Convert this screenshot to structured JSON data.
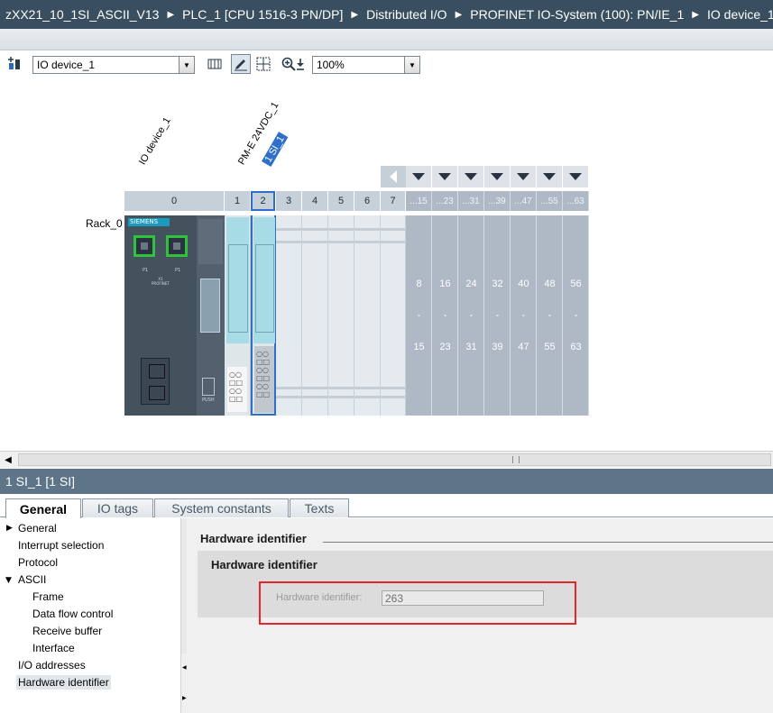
{
  "breadcrumb": [
    "zXX21_10_1SI_ASCII_V13",
    "PLC_1 [CPU 1516-3 PN/DP]",
    "Distributed I/O",
    "PROFINET IO-System (100): PN/IE_1",
    "IO device_1"
  ],
  "breadcrumb_separator": "▶",
  "toolbar": {
    "device_select": "IO device_1",
    "zoom_select": "100%"
  },
  "device_view": {
    "device_label": "IO device_1",
    "module_label": "PM-E 24VDC_1",
    "selected_module_label": "1 SI_1",
    "rack_label": "Rack_0",
    "slots": [
      "0",
      "1",
      "2",
      "3",
      "4",
      "5",
      "6",
      "7"
    ],
    "ext_headers": [
      "...15",
      "...23",
      "...31",
      "...39",
      "...47",
      "...55",
      "...63"
    ],
    "ext_top": [
      "8",
      "16",
      "24",
      "32",
      "40",
      "48",
      "56"
    ],
    "ext_dash": "-",
    "ext_bottom": [
      "15",
      "23",
      "31",
      "39",
      "47",
      "55",
      "63"
    ],
    "cpu_brand": "SIEMENS",
    "port_labels": [
      "P1",
      "P1"
    ],
    "cpu_text": "X1\nPROFINET",
    "push_label": "PUSH"
  },
  "properties": {
    "title": "1 SI_1 [1 SI]",
    "tabs": [
      "General",
      "IO tags",
      "System constants",
      "Texts"
    ],
    "nav": [
      {
        "label": "General",
        "level": 0,
        "caret": "▶"
      },
      {
        "label": "Interrupt selection",
        "level": 0
      },
      {
        "label": "Protocol",
        "level": 0
      },
      {
        "label": "ASCII",
        "level": 0,
        "caret": "▼"
      },
      {
        "label": "Frame",
        "level": 1
      },
      {
        "label": "Data flow control",
        "level": 1
      },
      {
        "label": "Receive buffer",
        "level": 1
      },
      {
        "label": "Interface",
        "level": 1
      },
      {
        "label": "I/O addresses",
        "level": 0
      },
      {
        "label": "Hardware identifier",
        "level": 0,
        "selected": true
      }
    ],
    "section_title": "Hardware identifier",
    "group_title": "Hardware identifier",
    "field_label": "Hardware identifier:",
    "field_value": "263"
  },
  "colors": {
    "breadcrumb_bg": "#394e5e",
    "properties_title_bg": "#5e7589",
    "selection_frame": "#2f6fc9",
    "highlight": "#e5242b",
    "module_fill": "#a7dbe6",
    "cpu_dark": "#44525e"
  }
}
